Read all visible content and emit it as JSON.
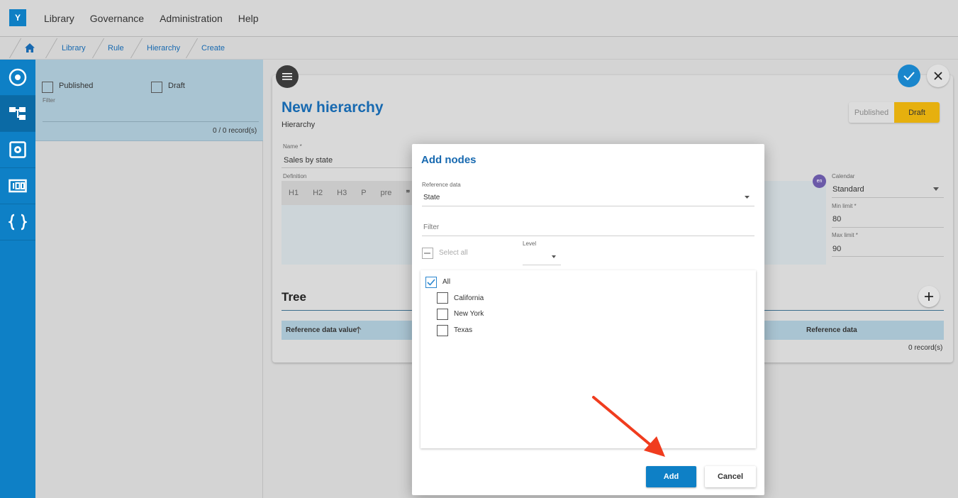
{
  "app": {
    "logo_letter": "Y"
  },
  "topnav": {
    "items": [
      "Library",
      "Governance",
      "Administration",
      "Help"
    ]
  },
  "breadcrumb": {
    "items": [
      "Library",
      "Rule",
      "Hierarchy",
      "Create"
    ]
  },
  "rail": {
    "icons": [
      "target-icon",
      "hierarchy-icon",
      "gear-box-icon",
      "counter-icon",
      "braces-icon"
    ],
    "active_index": 1
  },
  "filterpanel": {
    "published_label": "Published",
    "draft_label": "Draft",
    "filter_label": "Filter",
    "record_count": "0 / 0 record(s)"
  },
  "main": {
    "title": "New hierarchy",
    "subtitle": "Hierarchy",
    "status": {
      "published_label": "Published",
      "draft_label": "Draft",
      "selected": "Draft"
    },
    "name_label": "Name *",
    "name_value": "Sales by state",
    "definition_label": "Definition",
    "editor_buttons": [
      "H1",
      "H2",
      "H3",
      "P",
      "pre",
      "❞"
    ],
    "lang_badge": "en",
    "calendar_label": "Calendar",
    "calendar_value": "Standard",
    "min_limit_label": "Min limit *",
    "min_limit_value": "80",
    "max_limit_label": "Max limit *",
    "max_limit_value": "90",
    "tree_title": "Tree",
    "table_headers": {
      "col1": "Reference data value",
      "col2": "Reference data"
    },
    "record_count": "0 record(s)"
  },
  "dialog": {
    "title": "Add nodes",
    "reference_label": "Reference data",
    "reference_value": "State",
    "filter_placeholder": "Filter",
    "select_all_label": "Select all",
    "level_label": "Level",
    "tree": [
      {
        "label": "All",
        "checked": true
      },
      {
        "label": "California",
        "checked": false
      },
      {
        "label": "New York",
        "checked": false
      },
      {
        "label": "Texas",
        "checked": false
      }
    ],
    "add_label": "Add",
    "cancel_label": "Cancel"
  },
  "colors": {
    "brand_blue": "#0e80c6",
    "draft_yellow": "#e6b00e",
    "annotation_red": "#f03c1e"
  }
}
